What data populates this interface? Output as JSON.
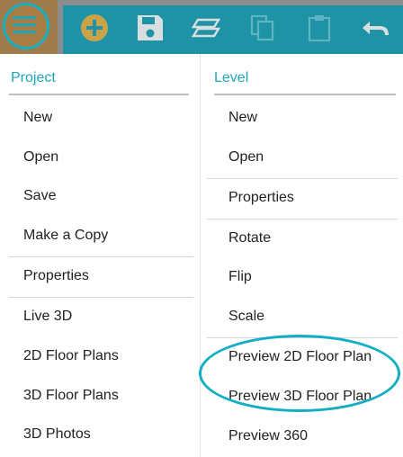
{
  "toolbar": {
    "icons": [
      "hamburger-menu-icon",
      "add-icon",
      "save-icon",
      "layers-icon",
      "copy-icon",
      "paste-icon",
      "undo-icon"
    ],
    "colors": {
      "strip": "#1e93a5",
      "accent": "#c9a24a",
      "menu_button": "#a87c45",
      "highlight": "#13aec4"
    }
  },
  "menu": {
    "project": {
      "header": "Project",
      "items": [
        "New",
        "Open",
        "Save",
        "Make a Copy",
        "Properties",
        "Live 3D",
        "2D Floor Plans",
        "3D Floor Plans",
        "3D Photos"
      ]
    },
    "level": {
      "header": "Level",
      "items": [
        "New",
        "Open",
        "Properties",
        "Rotate",
        "Flip",
        "Scale",
        "Preview 2D Floor Plan",
        "Preview 3D Floor Plan",
        "Preview 360"
      ]
    }
  }
}
